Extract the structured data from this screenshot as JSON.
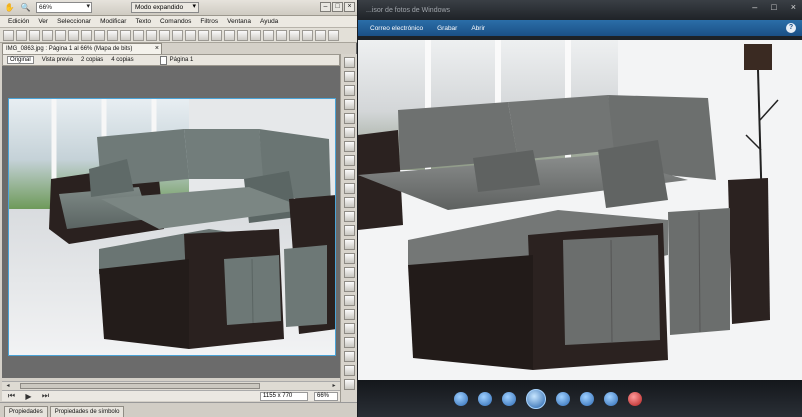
{
  "editor": {
    "zoom_value": "66%",
    "mode_value": "Modo expandido",
    "menu": [
      "Edición",
      "Ver",
      "Seleccionar",
      "Modificar",
      "Texto",
      "Comandos",
      "Filtros",
      "Ventana",
      "Ayuda"
    ],
    "document_tab": "IMG_0863.jpg : Página 1 al 66% (Mapa de bits)",
    "document_close": "×",
    "view_options": [
      "Original",
      "Vista previa",
      "2 copias",
      "4 copias"
    ],
    "page_label": "Página 1",
    "status_dimensions": "1155 x 770",
    "status_zoom": "66%",
    "panel_tabs": [
      "Propiedades",
      "Propiedades de símbolo"
    ]
  },
  "viewer": {
    "title": "...isor de fotos de Windows",
    "menu": [
      "Correo electrónico",
      "Grabar",
      "Abrir"
    ],
    "help": "?",
    "window_buttons": [
      "–",
      "□",
      "×"
    ]
  },
  "colors": {
    "accent_blue": "#2b6ea8",
    "sofa_leather": "#2a211f",
    "sofa_fabric": "#6f7a78"
  }
}
